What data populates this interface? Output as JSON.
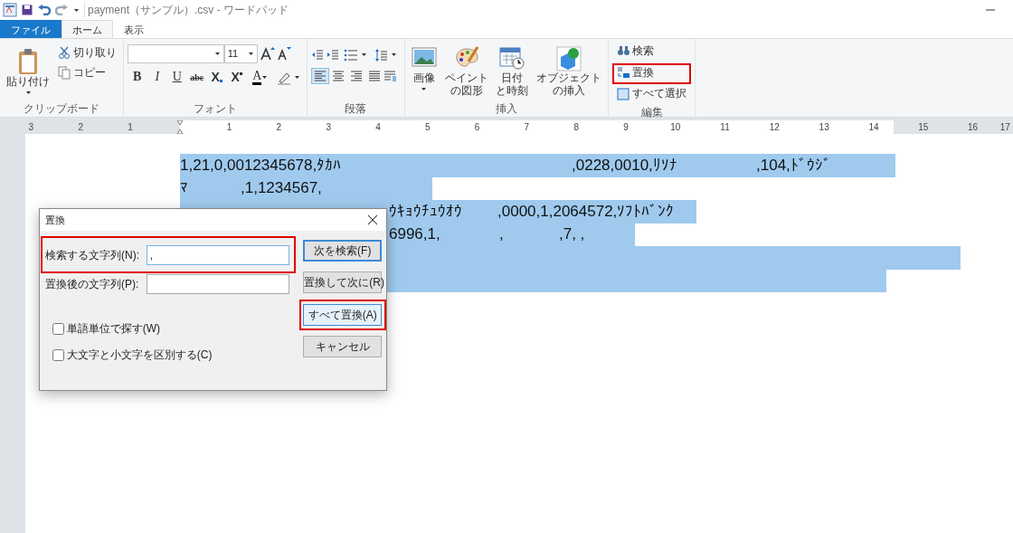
{
  "window": {
    "title": "payment（サンプル）.csv - ワードパッド"
  },
  "ribbon_tabs": [
    {
      "label": "ファイル",
      "kind": "file",
      "selected": false
    },
    {
      "label": "ホーム",
      "kind": "tab",
      "selected": true
    },
    {
      "label": "表示",
      "kind": "tab",
      "selected": false
    }
  ],
  "clipboard": {
    "label": "クリップボード",
    "paste": "貼り付け",
    "items": [
      "切り取り",
      "コピー"
    ]
  },
  "font": {
    "label": "フォント",
    "size": "11",
    "format_buttons": [
      {
        "label": "B",
        "kind": "bold"
      },
      {
        "label": "I",
        "kind": "italic"
      },
      {
        "label": "U",
        "kind": "underline"
      },
      {
        "label": "abc",
        "kind": "strike"
      },
      {
        "label": "X",
        "kind": "subscript"
      },
      {
        "label": "X",
        "kind": "superscript"
      },
      {
        "label": "A",
        "kind": "color"
      }
    ]
  },
  "paragraph": {
    "label": "段落",
    "alignments": [
      {
        "selected": true
      },
      {
        "selected": false
      },
      {
        "selected": false
      },
      {
        "selected": false
      }
    ]
  },
  "insert": {
    "label": "挿入",
    "items": [
      {
        "kind": "image",
        "lines": [
          "画像"
        ]
      },
      {
        "kind": "paint",
        "lines": [
          "ペイント",
          "の図形"
        ]
      },
      {
        "kind": "datetime",
        "lines": [
          "日付",
          "と時刻"
        ]
      },
      {
        "kind": "object",
        "lines": [
          "オブジェクト",
          "の挿入"
        ]
      }
    ]
  },
  "editing": {
    "label": "編集",
    "items": [
      {
        "kind": "find",
        "label": "検索",
        "highlighted": false
      },
      {
        "kind": "replace",
        "label": "置換",
        "highlighted": true
      },
      {
        "kind": "selectall",
        "label": "すべて選択",
        "highlighted": false
      }
    ]
  },
  "ruler": {
    "left_labels": [
      "3",
      "2",
      "1"
    ],
    "right_labels": [
      "1",
      "2",
      "3",
      "4",
      "5",
      "6",
      "7",
      "8",
      "9",
      "10",
      "11",
      "12",
      "13",
      "14",
      "15",
      "16",
      "17"
    ]
  },
  "document": {
    "lines": [
      {
        "selected": true,
        "segments": [
          "1,21,0,0012345678,ﾀｶﾊ",
          ",0228,0010,ﾘｿﾅ",
          ",104,ﾄﾞｳｼﾞ"
        ]
      },
      {
        "selected": true,
        "segments": [
          "ﾏ",
          ",1,1234567,"
        ]
      },
      {
        "selected": true,
        "segments": [
          "ｳｷｮｳﾁｭｳｵｳ",
          ",0000,1,2064572,ｿﾌﾄﾊﾞﾝｸ"
        ]
      },
      {
        "selected": true,
        "segments": [
          "6996,1,",
          ",",
          ",7, ,"
        ]
      },
      {
        "selected": true
      },
      {
        "selected": true
      }
    ]
  },
  "dialog": {
    "title": "置換",
    "fields": [
      {
        "label": "検索する文字列(N):",
        "value": ",",
        "highlighted": true
      },
      {
        "label": "置換後の文字列(P):",
        "highlighted": false
      }
    ],
    "checkboxes": [
      {
        "label": "単語単位で探す(W)",
        "checked": false
      },
      {
        "label": "大文字と小文字を区別する(C)",
        "checked": false
      }
    ],
    "buttons": [
      {
        "label": "次を検索(F)",
        "kind": "default",
        "highlighted": false
      },
      {
        "label": "置換して次に(R)",
        "kind": "normal",
        "highlighted": false
      },
      {
        "label": "すべて置換(A)",
        "kind": "focused",
        "highlighted": true
      },
      {
        "label": "キャンセル",
        "kind": "normal",
        "highlighted": false
      }
    ]
  }
}
